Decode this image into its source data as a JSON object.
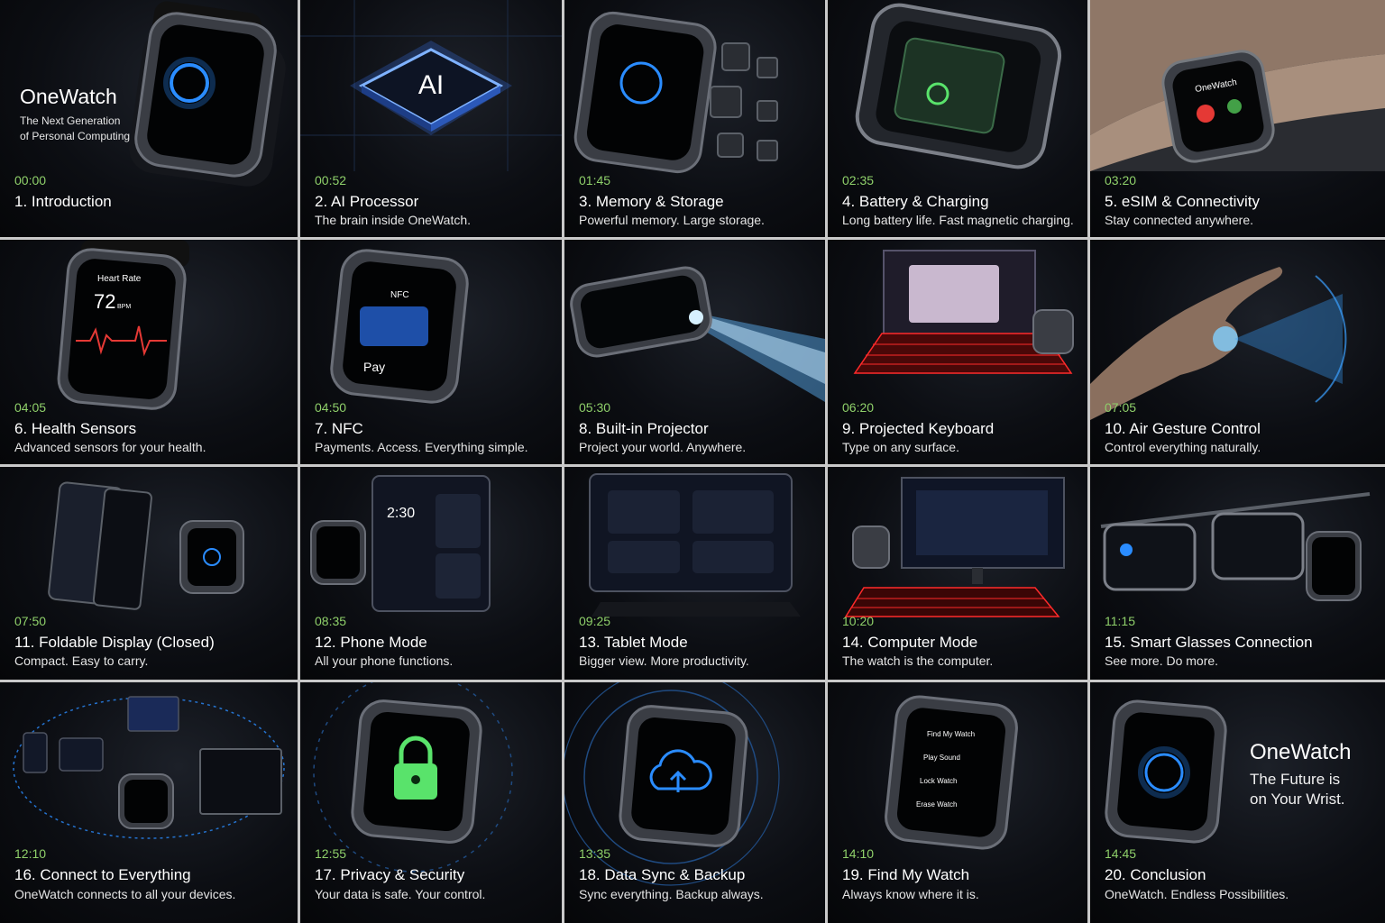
{
  "intro": {
    "brand": "OneWatch",
    "tagline_line1": "The Next Generation",
    "tagline_line2": "of Personal Computing",
    "time": "00:00",
    "title": "1. Introduction"
  },
  "tiles": [
    {
      "time": "00:52",
      "title": "2. AI Processor",
      "caption": "The brain inside OneWatch.",
      "screen_text": "AI"
    },
    {
      "time": "01:45",
      "title": "3. Memory & Storage",
      "caption": "Powerful memory. Large storage."
    },
    {
      "time": "02:35",
      "title": "4. Battery & Charging",
      "caption": "Long battery life. Fast magnetic charging."
    },
    {
      "time": "03:20",
      "title": "5. eSIM & Connectivity",
      "caption": "Stay connected anywhere.",
      "screen_text": "OneWatch"
    },
    {
      "time": "04:05",
      "title": "6. Health Sensors",
      "caption": "Advanced sensors for your health.",
      "screen_label": "Heart Rate",
      "screen_value": "72",
      "screen_unit": "BPM"
    },
    {
      "time": "04:50",
      "title": "7. NFC",
      "caption": "Payments.  Access.  Everything simple.",
      "screen_label": "NFC",
      "screen_value": "Pay"
    },
    {
      "time": "05:30",
      "title": "8. Built-in Projector",
      "caption": "Project your world. Anywhere."
    },
    {
      "time": "06:20",
      "title": "9. Projected Keyboard",
      "caption": "Type on any surface."
    },
    {
      "time": "07:05",
      "title": "10. Air Gesture Control",
      "caption": "Control everything naturally."
    },
    {
      "time": "07:50",
      "title": "11. Foldable Display (Closed)",
      "caption": "Compact. Easy to carry."
    },
    {
      "time": "08:35",
      "title": "12. Phone Mode",
      "caption": "All your phone functions.",
      "screen_value": "2:30"
    },
    {
      "time": "09:25",
      "title": "13. Tablet Mode",
      "caption": "Bigger view. More productivity."
    },
    {
      "time": "10:20",
      "title": "14. Computer Mode",
      "caption": "The watch is the computer."
    },
    {
      "time": "11:15",
      "title": "15. Smart Glasses Connection",
      "caption": "See more. Do more."
    },
    {
      "time": "12:10",
      "title": "16. Connect to Everything",
      "caption": "OneWatch connects to all your devices."
    },
    {
      "time": "12:55",
      "title": "17. Privacy & Security",
      "caption": "Your data is safe. Your control."
    },
    {
      "time": "13:35",
      "title": "18. Data Sync & Backup",
      "caption": "Sync everything. Backup always."
    },
    {
      "time": "14:10",
      "title": "19. Find My Watch",
      "caption": "Always know where it is.",
      "menu": [
        "Find My Watch",
        "Play Sound",
        "Lock Watch",
        "Erase Watch"
      ]
    }
  ],
  "conclusion": {
    "brand": "OneWatch",
    "line1": "The Future is",
    "line2": "on Your Wrist.",
    "time": "14:45",
    "title": "20. Conclusion",
    "caption": "OneWatch. Endless Possibilities."
  },
  "colors": {
    "timestamp": "#8fd06a",
    "glow_blue": "#2a8cff",
    "glow_green": "#59e36b",
    "keyboard_red": "#ff2a2a",
    "background": "#0c0e13"
  }
}
